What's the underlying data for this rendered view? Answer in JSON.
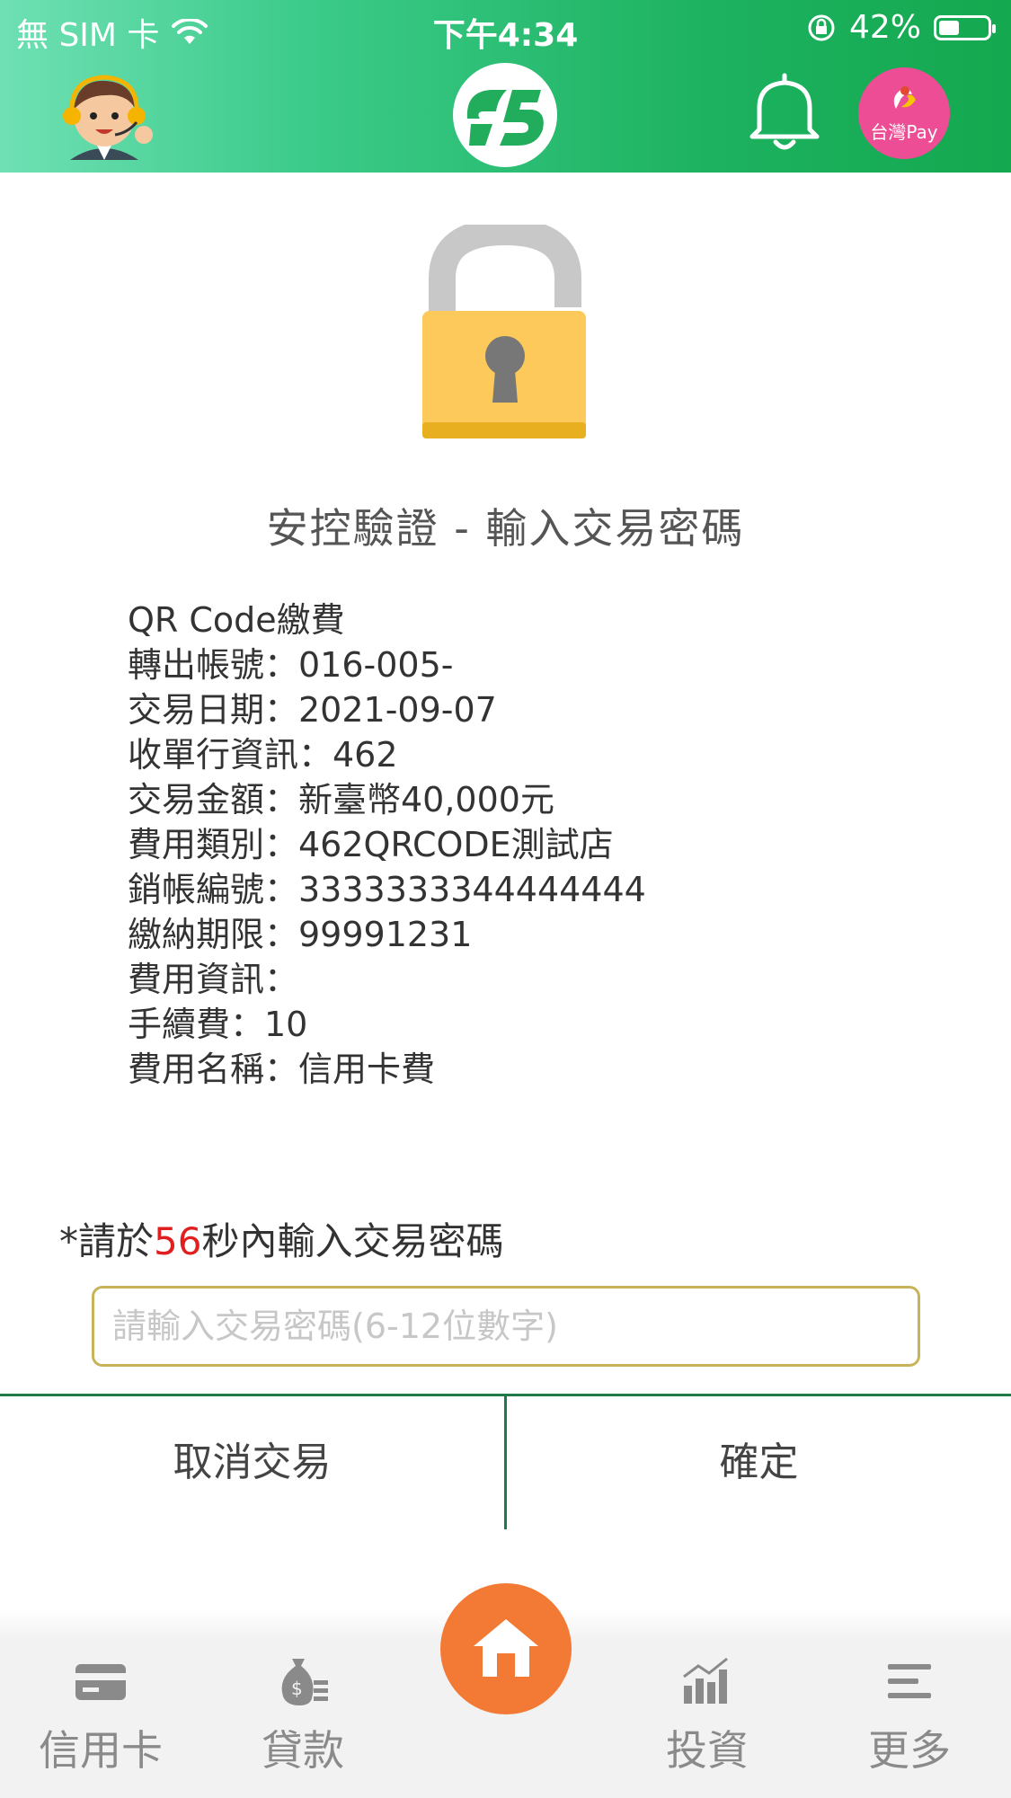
{
  "status_bar": {
    "carrier": "無 SIM 卡",
    "time": "下午4:34",
    "battery": "42%",
    "battery_level": 0.42
  },
  "header": {
    "avatar_icon": "customer-service-avatar-icon",
    "logo_icon": "bank-95-logo-icon",
    "bell_icon": "bell-icon",
    "pay_label": "台灣Pay",
    "brand_green": "#14a84f",
    "pay_pink": "#ec4d94"
  },
  "lock_icon": "unlocked-padlock-icon",
  "title": "安控驗證 - 輸入交易密碼",
  "details": [
    "QR Code繳費",
    "轉出帳號：016-005-",
    "交易日期：2021-09-07",
    "收單行資訊：462",
    "交易金額：新臺幣40,000元",
    "費用類別：462QRCODE測試店",
    "銷帳編號：3333333344444444",
    "繳納期限：99991231",
    "費用資訊：",
    "手續費：10",
    "費用名稱：信用卡費"
  ],
  "countdown": {
    "prefix": "*請於",
    "seconds": "56",
    "suffix": "秒內輸入交易密碼",
    "seconds_color": "#e02020"
  },
  "password_input": {
    "value": "",
    "placeholder": "請輸入交易密碼(6-12位數字)"
  },
  "actions": {
    "cancel_label": "取消交易",
    "confirm_label": "確定"
  },
  "tabbar": {
    "items": [
      {
        "label": "信用卡",
        "icon": "credit-card-icon"
      },
      {
        "label": "貸款",
        "icon": "money-bag-icon"
      },
      {
        "label": "投資",
        "icon": "bar-chart-icon"
      },
      {
        "label": "更多",
        "icon": "menu-icon"
      }
    ],
    "home_icon": "home-icon",
    "home_color": "#f27a35"
  }
}
